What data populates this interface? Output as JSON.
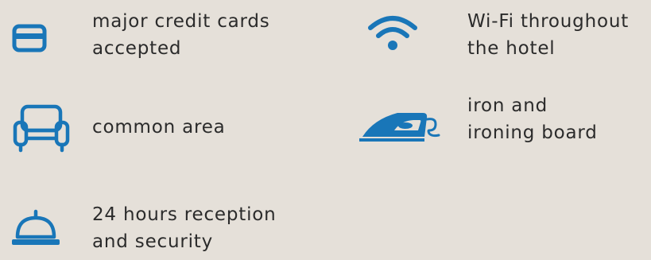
{
  "accent_color": "#1976b8",
  "background_color": "#e5e0d9",
  "amenities": [
    {
      "icon": "credit-card-icon",
      "lines": [
        "major credit cards",
        "accepted"
      ]
    },
    {
      "icon": "wifi-icon",
      "lines": [
        "Wi-Fi throughout",
        "the hotel"
      ]
    },
    {
      "icon": "armchair-icon",
      "lines": [
        "common area"
      ]
    },
    {
      "icon": "iron-icon",
      "lines": [
        "iron and",
        "ironing board"
      ]
    },
    {
      "icon": "reception-bell-icon",
      "lines": [
        "24 hours reception",
        "and security"
      ]
    }
  ]
}
